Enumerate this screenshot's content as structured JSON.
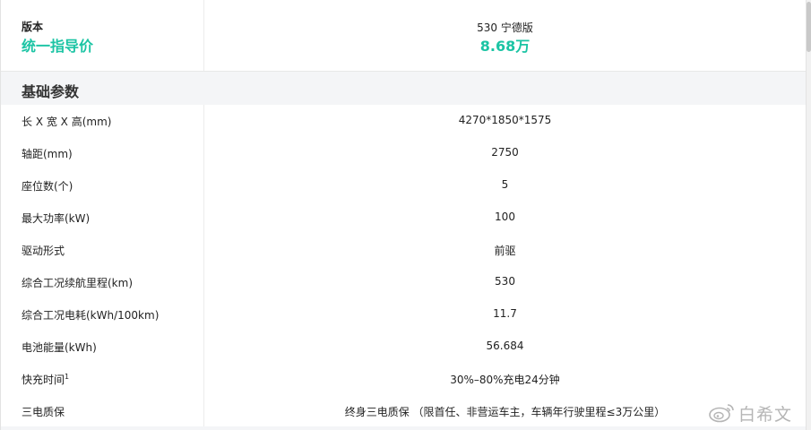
{
  "header": {
    "version_label": "版本",
    "price_label": "统一指导价",
    "variant_name": "530 宁德版",
    "price_value": "8.68万"
  },
  "section": {
    "title": "基础参数"
  },
  "rows": [
    {
      "label": "长 X 宽 X 高(mm)",
      "value": "4270*1850*1575"
    },
    {
      "label": "轴距(mm)",
      "value": "2750"
    },
    {
      "label": "座位数(个)",
      "value": "5"
    },
    {
      "label": "最大功率(kW)",
      "value": "100"
    },
    {
      "label": "驱动形式",
      "value": "前驱"
    },
    {
      "label": "综合工况续航里程(km)",
      "value": "530"
    },
    {
      "label": "综合工况电耗(kWh/100km)",
      "value": "11.7"
    },
    {
      "label": "电池能量(kWh)",
      "value": "56.684"
    },
    {
      "label": "快充时间",
      "label_sup": "1",
      "value": "30%–80%充电24分钟"
    },
    {
      "label": "三电质保",
      "value": "终身三电质保 （限首任、非营运车主，车辆年行驶里程≤3万公里）"
    }
  ],
  "watermark": {
    "text": "白希文",
    "icon": "weibo-icon"
  },
  "colors": {
    "accent": "#1bc4a4",
    "section_bg": "#f4f5f7",
    "divider": "#ececec"
  }
}
